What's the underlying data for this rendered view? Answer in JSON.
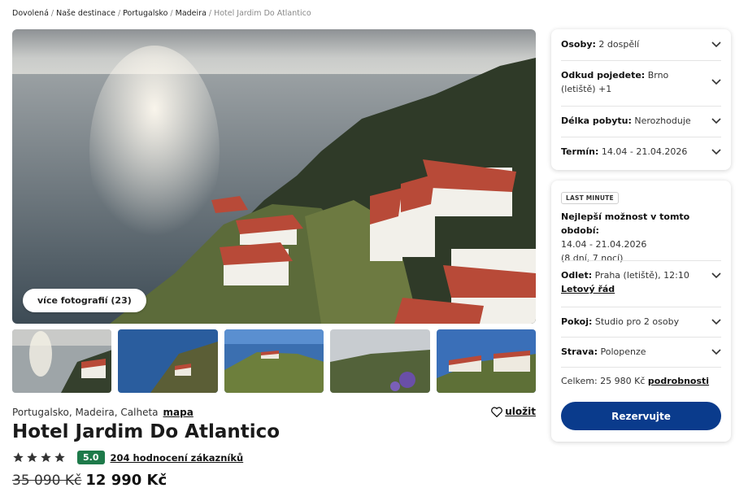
{
  "breadcrumb": {
    "items": [
      "Dovolená",
      "Naše destinace",
      "Portugalsko",
      "Madeira"
    ],
    "current": "Hotel Jardim Do Atlantico"
  },
  "gallery": {
    "more_photos_label": "více fotografií (23)"
  },
  "hotel": {
    "location": "Portugalsko, Madeira, Calheta",
    "map_link": "mapa",
    "save_label": "uložit",
    "title": "Hotel Jardim Do Atlantico",
    "stars": 4,
    "score": "5.0",
    "reviews_link": "204 hodnocení zákazníků",
    "old_price": "35 090 Kč",
    "new_price": "12 990 Kč"
  },
  "filters": {
    "persons_label": "Osoby:",
    "persons_value": "2 dospělí",
    "from_label": "Odkud pojedete:",
    "from_value_1": "Brno",
    "from_value_2": "(letiště) +1",
    "duration_label": "Délka pobytu:",
    "duration_value": "Nerozhoduje",
    "term_label": "Termín:",
    "term_value": "14.04 - 21.04.2026"
  },
  "offer": {
    "badge": "LAST MINUTE",
    "best_label": "Nejlepší možnost v tomto období:",
    "dates": "14.04 - 21.04.2026",
    "nights": "(8 dní, 7 nocí)",
    "departure_label": "Odlet:",
    "departure_value": "Praha (letiště), 12:10",
    "schedule_link": "Letový řád",
    "room_label": "Pokoj:",
    "room_value": "Studio pro 2 osoby",
    "board_label": "Strava:",
    "board_value": "Polopenze",
    "total_label": "Celkem: 25 980 Kč",
    "details_link": "podrobnosti",
    "reserve_button": "Rezervujte"
  },
  "colors": {
    "accent": "#0a3b8c",
    "score_green": "#1e7a4a"
  }
}
